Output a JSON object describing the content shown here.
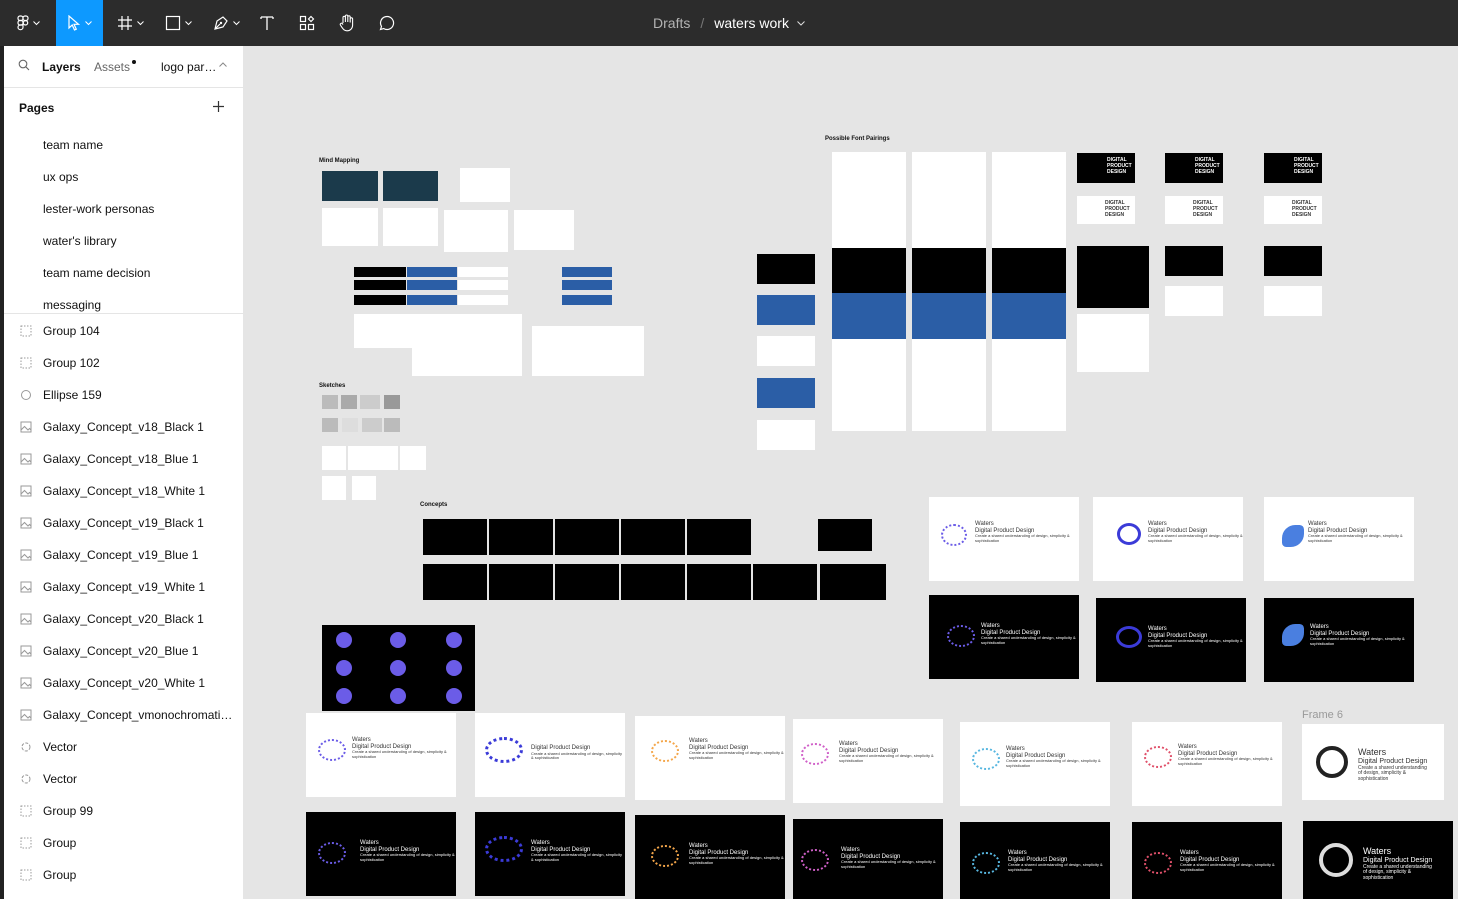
{
  "toolbar": {
    "breadcrumb": "Drafts",
    "separator": "/",
    "file_name": "waters work",
    "accent": "#0d99ff",
    "tools": [
      "main-menu",
      "move",
      "frame",
      "shape",
      "pen",
      "text",
      "components",
      "hand",
      "comment"
    ]
  },
  "sidebar": {
    "tab_layers": "Layers",
    "tab_assets": "Assets",
    "page_switcher": "logo par…",
    "pages_label": "Pages",
    "pages": [
      "team name",
      "ux ops",
      "lester-work personas",
      "water's library",
      "team name decision",
      "messaging"
    ],
    "layers": [
      {
        "name": "Group 104",
        "icon": "group-icon"
      },
      {
        "name": "Group 102",
        "icon": "group-icon"
      },
      {
        "name": "Ellipse 159",
        "icon": "ellipse-icon"
      },
      {
        "name": "Galaxy_Concept_v18_Black 1",
        "icon": "image-icon"
      },
      {
        "name": "Galaxy_Concept_v18_Blue 1",
        "icon": "image-icon"
      },
      {
        "name": "Galaxy_Concept_v18_White 1",
        "icon": "image-icon"
      },
      {
        "name": "Galaxy_Concept_v19_Black 1",
        "icon": "image-icon"
      },
      {
        "name": "Galaxy_Concept_v19_Blue 1",
        "icon": "image-icon"
      },
      {
        "name": "Galaxy_Concept_v19_White 1",
        "icon": "image-icon"
      },
      {
        "name": "Galaxy_Concept_v20_Black 1",
        "icon": "image-icon"
      },
      {
        "name": "Galaxy_Concept_v20_Blue 1",
        "icon": "image-icon"
      },
      {
        "name": "Galaxy_Concept_v20_White 1",
        "icon": "image-icon"
      },
      {
        "name": "Galaxy_Concept_vmonochromatic…",
        "icon": "image-icon"
      },
      {
        "name": "Vector",
        "icon": "vector-icon"
      },
      {
        "name": "Vector",
        "icon": "vector-icon"
      },
      {
        "name": "Group 99",
        "icon": "group-icon"
      },
      {
        "name": "Group",
        "icon": "group-icon"
      },
      {
        "name": "Group",
        "icon": "group-icon"
      }
    ]
  },
  "canvas": {
    "labels": {
      "mind_mapping": "Mind Mapping",
      "sketches": "Sketches",
      "concepts": "Concepts",
      "font_pairings": "Possible Font Pairings",
      "frame6": "Frame 6"
    },
    "dpd_lines": [
      "DIGITAL",
      "PRODUCT",
      "DESIGN"
    ],
    "logo": {
      "brand": "Waters",
      "subtitle": "Digital Product Design",
      "tagline": "Create a shared understanding of design, simplicity & sophistication"
    },
    "logo_colors": [
      "#6b5ce7",
      "#3b3bd8",
      "#f4a64a",
      "#d060c8",
      "#58b7e0",
      "#e0506a",
      "#222222"
    ]
  }
}
